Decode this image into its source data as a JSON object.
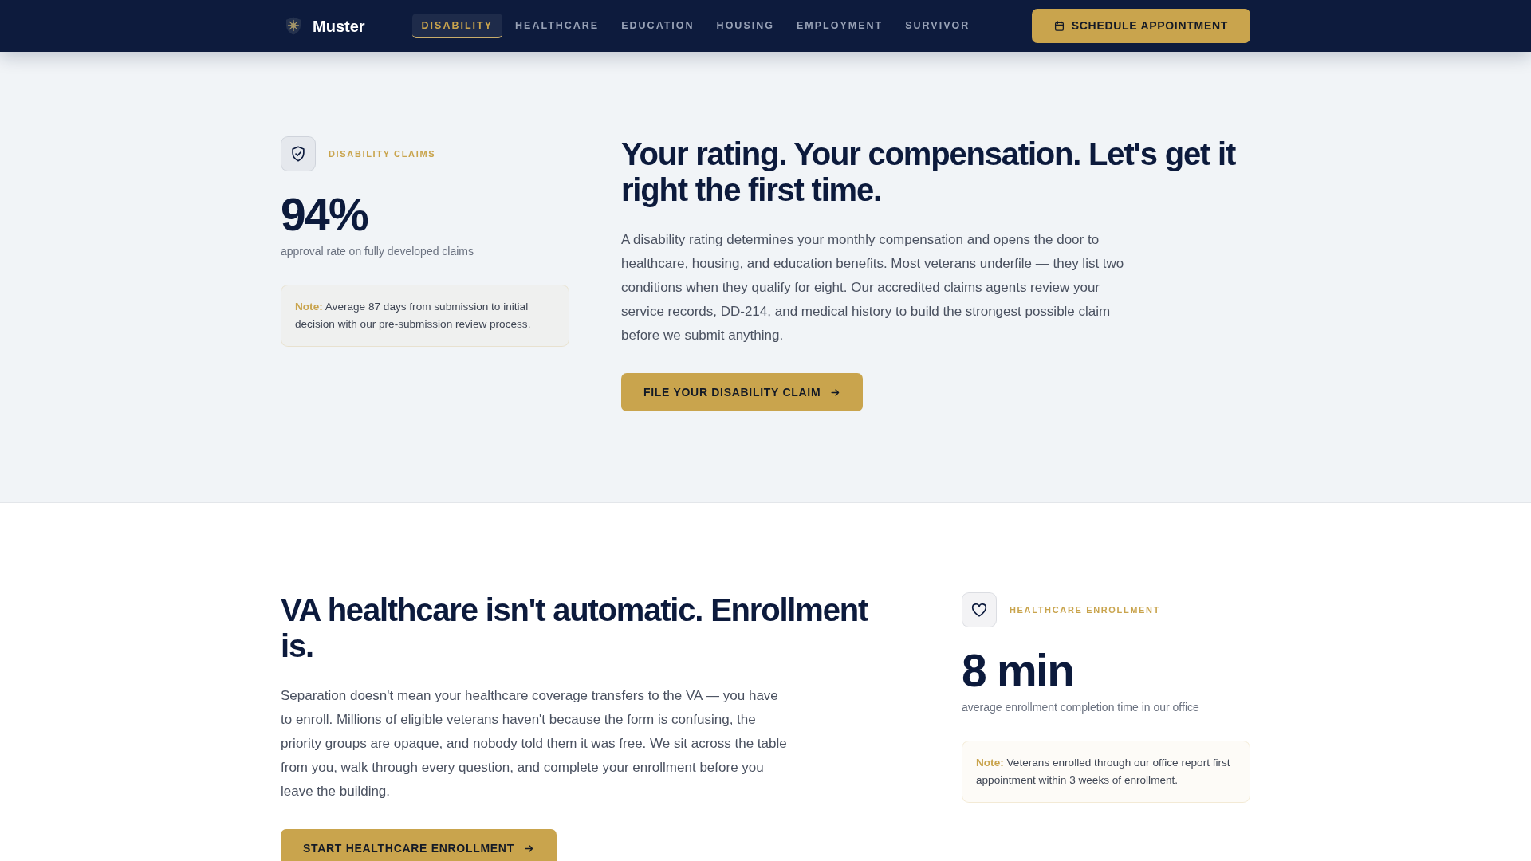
{
  "navbar": {
    "brand": "Muster",
    "tabs": [
      {
        "label": "DISABILITY",
        "selected": true
      },
      {
        "label": "HEALTHCARE",
        "selected": false
      },
      {
        "label": "EDUCATION",
        "selected": false
      },
      {
        "label": "HOUSING",
        "selected": false
      },
      {
        "label": "EMPLOYMENT",
        "selected": false
      },
      {
        "label": "SURVIVOR",
        "selected": false
      }
    ],
    "action": "SCHEDULE APPOINTMENT"
  },
  "sections": [
    {
      "panels": [
        {
          "kind": "stat",
          "label": "DISABILITY CLAIMS",
          "value": "94%",
          "caption": "approval rate on fully developed claims",
          "note": "**Note:** Average 87 days from submission to initial decision with our pre-submission review process."
        },
        {
          "kind": "pitch",
          "heading": "Your rating. Your compensation. Let's get it right the first time.",
          "body": "A disability rating determines your monthly compensation and opens the door to healthcare, housing, and education benefits. Most veterans underfile — they list two conditions when they qualify for eight. Our accredited claims agents review your service records, DD-214, and medical history to build the strongest possible claim before we submit anything.",
          "button": "FILE YOUR DISABILITY CLAIM"
        }
      ]
    },
    {
      "panels": [
        {
          "kind": "pitch",
          "heading": "VA healthcare isn't automatic. Enrollment is.",
          "body": "Separation doesn't mean your healthcare coverage transfers to the VA — you have to enroll. Millions of eligible veterans haven't because the form is confusing, the priority groups are opaque, and nobody told them it was free. We sit across the table from you, walk through every question, and complete your enrollment before you leave the building.",
          "button": "START HEALTHCARE ENROLLMENT"
        },
        {
          "kind": "stat",
          "label": "HEALTHCARE ENROLLMENT",
          "value": "8 min",
          "caption": "average enrollment completion time in our office",
          "note": "**Note:** Veterans enrolled through our office report first appointment within 3 weeks of enrollment."
        }
      ]
    }
  ]
}
